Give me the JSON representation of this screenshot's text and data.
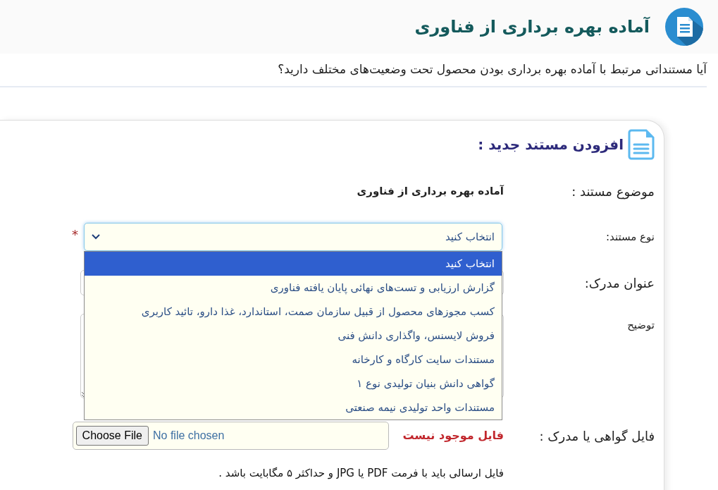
{
  "header": {
    "title": "آماده بهره برداری از فناوری"
  },
  "question": "آیا مستنداتی مرتبط با آماده بهره برداری بودن محصول تحت وضعیت‌های مختلف دارید؟",
  "form": {
    "title": "افزودن مستند جدید :",
    "subject": {
      "label": "موضوع مستند :",
      "value": "آماده بهره برداری از فناوری"
    },
    "doc_type": {
      "label": "نوع مستند:",
      "value": "انتخاب کنید",
      "required_mark": "*",
      "expanded": true,
      "options": [
        {
          "label": "انتخاب کنید",
          "selected": true
        },
        {
          "label": "گزارش ارزیابی و تست‌های نهائی پایان یافته فناوری",
          "selected": false
        },
        {
          "label": "کسب مجوزهای محصول از قبیل سازمان صمت، استاندارد، غذا دارو، تائید کاربری",
          "selected": false
        },
        {
          "label": "فروش لایسنس، واگذاری دانش فنی",
          "selected": false
        },
        {
          "label": "مستندات سایت کارگاه و کارخانه",
          "selected": false
        },
        {
          "label": "گواهی دانش بنیان تولیدی نوع ۱",
          "selected": false
        },
        {
          "label": "مستندات واحد تولیدی نیمه صنعتی",
          "selected": false
        }
      ]
    },
    "doc_title": {
      "label": "عنوان مدرک:"
    },
    "description": {
      "label": "توضیح"
    },
    "file": {
      "label": "فایل گواهی یا مدرک :",
      "button": "Choose File",
      "status": "No file chosen",
      "note": "فایل موجود نیست"
    },
    "help_text": "فایل ارسالی باید با فرمت PDF یا JPG و حداکثر ۵ مگابایت باشد ."
  }
}
